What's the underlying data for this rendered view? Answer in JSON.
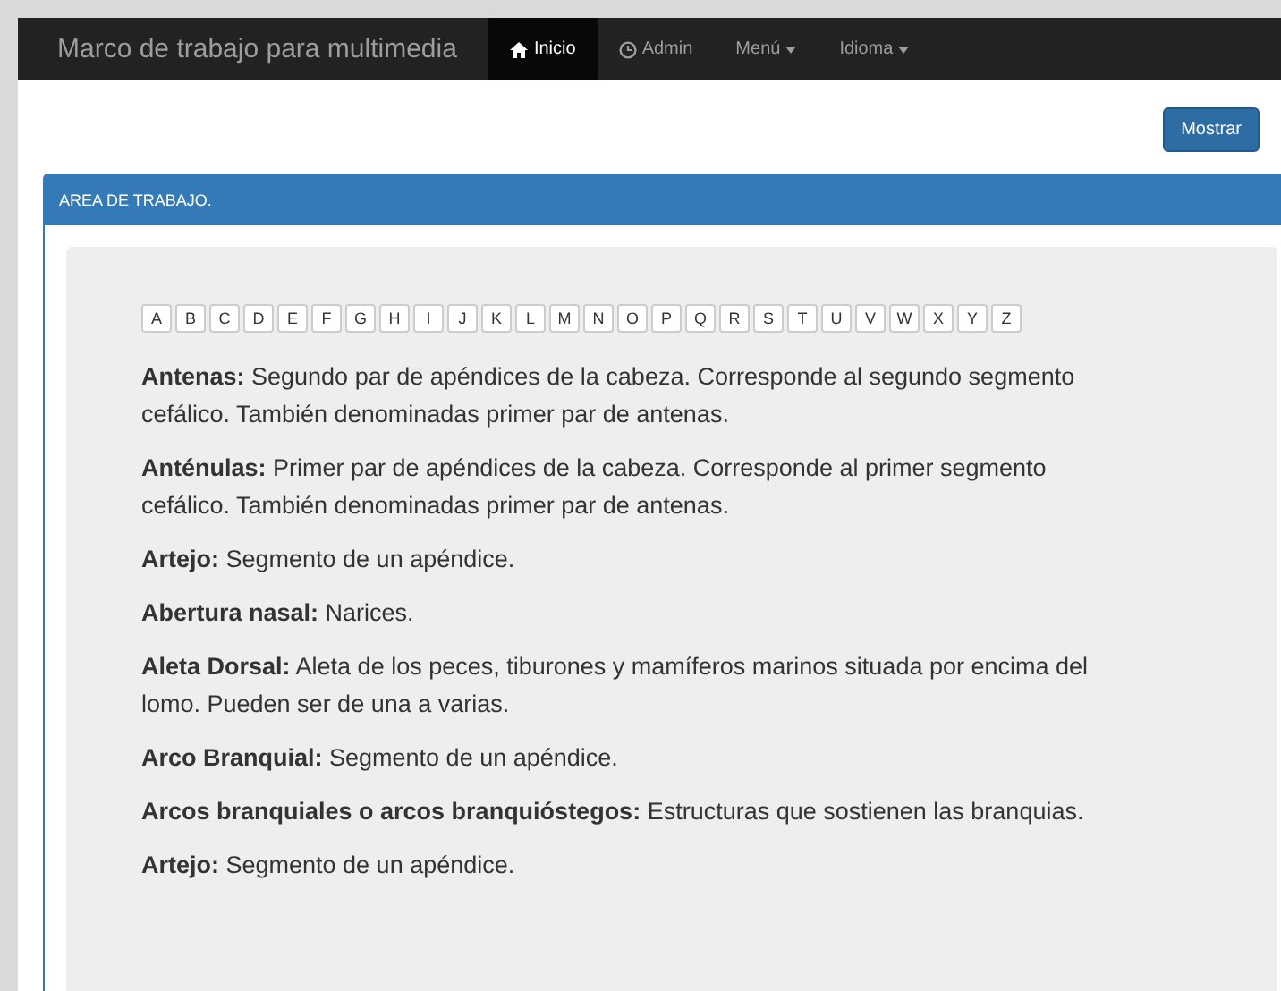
{
  "navbar": {
    "brand": "Marco de trabajo para multimedia",
    "items": [
      {
        "label": "Inicio",
        "kind": "home",
        "dropdown": false,
        "selected": true
      },
      {
        "label": "Admin",
        "kind": "clock",
        "dropdown": false,
        "selected": false
      },
      {
        "label": "Menú",
        "kind": "plain",
        "dropdown": true,
        "selected": false
      },
      {
        "label": "Idioma",
        "kind": "plain",
        "dropdown": true,
        "selected": false
      }
    ]
  },
  "show_button": "Mostrar",
  "panel": {
    "title": "AREA DE TRABAJO.",
    "letters": [
      "A",
      "B",
      "C",
      "D",
      "E",
      "F",
      "G",
      "H",
      "I",
      "J",
      "K",
      "L",
      "M",
      "N",
      "O",
      "P",
      "Q",
      "R",
      "S",
      "T",
      "U",
      "V",
      "W",
      "X",
      "Y",
      "Z"
    ],
    "entries": [
      "**Antenas:** Segundo par de apéndices de la cabeza. Corresponde al segundo segmento cefálico. También denominadas primer par de antenas.",
      "**Anténulas:** Primer par de apéndices de la cabeza. Corresponde al primer segmento cefálico. También denominadas primer par de antenas.",
      "**Artejo:** Segmento de un apéndice.",
      "**Abertura nasal:** Narices.",
      "**Aleta Dorsal:** Aleta de los peces, tiburones y mamíferos marinos situada por encima del lomo. Pueden ser de una a varias.",
      "**Arco Branquial:** Segmento de un apéndice.",
      "**Arcos branquiales o arcos branquióstegos:** Estructuras que sostienen las branquias.",
      "**Artejo:** Segmento de un apéndice."
    ]
  }
}
